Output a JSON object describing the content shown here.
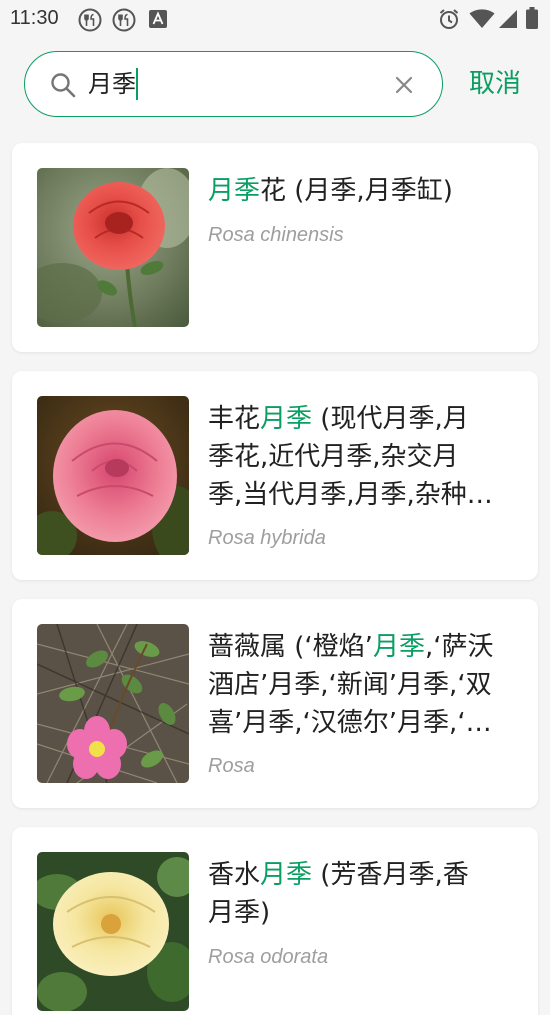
{
  "status_bar": {
    "time": "11:30"
  },
  "search": {
    "query": "月季",
    "cancel_label": "取消"
  },
  "results": [
    {
      "title_highlight": "月季",
      "title_after": "花 (月季,月季缸)",
      "scientific_name": "Rosa chinensis"
    },
    {
      "title_before": "丰花",
      "title_highlight": "月季",
      "line1_after": " (现代月季,月",
      "line2": "季花,近代月季,杂交月",
      "line3": "季,当代月季,月季,杂种…",
      "scientific_name": "Rosa hybrida"
    },
    {
      "title_before": "蔷薇属 (‘橙焰’",
      "title_highlight": "月季",
      "line1_after": ",‘萨沃",
      "line2": "酒店’月季,‘新闻’月季,‘双",
      "line3": "喜’月季,‘汉德尔’月季,‘…",
      "scientific_name": "Rosa"
    },
    {
      "title_before": "香水",
      "title_highlight": "月季",
      "line1_after": " (芳香月季,香",
      "line2": "月季)",
      "scientific_name": "Rosa odorata"
    }
  ],
  "colors": {
    "accent": "#0a9e62",
    "background": "#f5f5f5",
    "card": "#ffffff",
    "secondary_text": "#9e9e9e"
  }
}
